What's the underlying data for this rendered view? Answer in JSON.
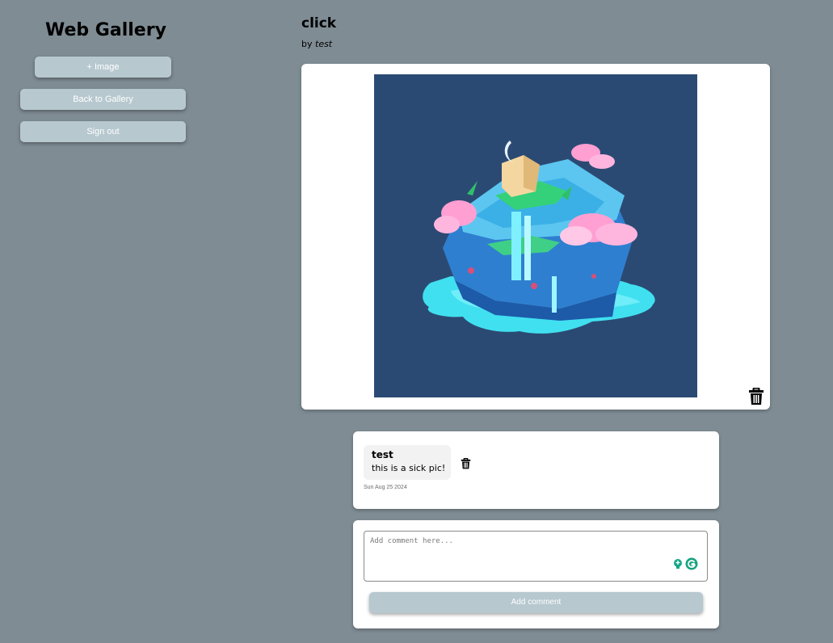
{
  "sidebar": {
    "title": "Web Gallery",
    "buttons": {
      "add_image": "+ Image",
      "back_to_gallery": "Back to Gallery",
      "sign_out": "Sign out"
    }
  },
  "image": {
    "title": "click",
    "byline_prefix": "by",
    "author": "test",
    "delete_icon": "trash-icon"
  },
  "comments": [
    {
      "author": "test",
      "text": "this is a sick pic!",
      "date": "Sun Aug 25 2024",
      "delete_icon": "trash-icon"
    }
  ],
  "add_comment": {
    "placeholder": "Add comment here...",
    "value": "",
    "button_label": "Add comment"
  },
  "colors": {
    "page_background": "#7f8c94",
    "button_background": "#b7c8cf",
    "card_background": "#ffffff",
    "image_background": "#2b4a73"
  }
}
